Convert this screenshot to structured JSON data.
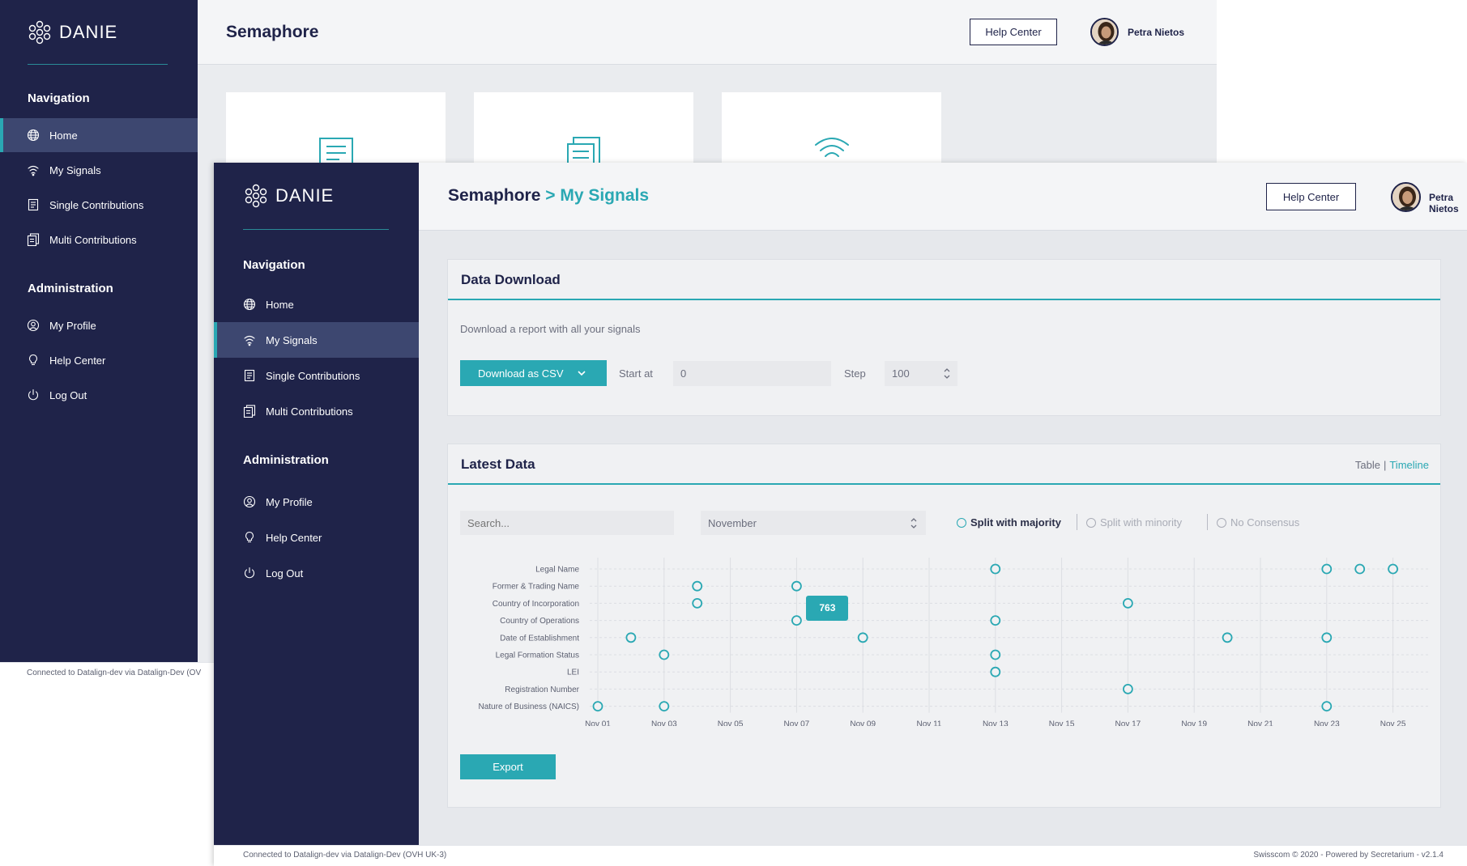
{
  "back_window": {
    "brand": "DANIE",
    "nav_heading": "Navigation",
    "nav": [
      {
        "label": "Home",
        "icon": "globe-icon",
        "active": true
      },
      {
        "label": "My Signals",
        "icon": "signal-icon"
      },
      {
        "label": "Single Contributions",
        "icon": "document-icon"
      },
      {
        "label": "Multi Contributions",
        "icon": "documents-icon"
      }
    ],
    "admin_heading": "Administration",
    "admin": [
      {
        "label": "My Profile",
        "icon": "profile-icon"
      },
      {
        "label": "Help Center",
        "icon": "bulb-icon"
      },
      {
        "label": "Log Out",
        "icon": "power-icon"
      }
    ],
    "title": "Semaphore",
    "help_center": "Help Center",
    "user": "Petra Nietos",
    "footer": "Connected to Datalign-dev via Datalign-Dev (OV",
    "tiles": [
      {
        "icon": "document-icon"
      },
      {
        "icon": "documents-icon"
      },
      {
        "icon": "signal-icon"
      }
    ]
  },
  "front_window": {
    "brand": "DANIE",
    "nav_heading": "Navigation",
    "nav": [
      {
        "label": "Home",
        "icon": "globe-icon"
      },
      {
        "label": "My Signals",
        "icon": "signal-icon",
        "active": true
      },
      {
        "label": "Single Contributions",
        "icon": "document-icon"
      },
      {
        "label": "Multi Contributions",
        "icon": "documents-icon"
      }
    ],
    "admin_heading": "Administration",
    "admin": [
      {
        "label": "My Profile",
        "icon": "profile-icon"
      },
      {
        "label": "Help Center",
        "icon": "bulb-icon"
      },
      {
        "label": "Log Out",
        "icon": "power-icon"
      }
    ],
    "title": "Semaphore",
    "breadcrumb_sep": ">",
    "breadcrumb": "My Signals",
    "help_center": "Help Center",
    "user": "Petra Nietos",
    "data_download": {
      "title": "Data Download",
      "description": "Download a report with all your signals",
      "download_button": "Download as CSV",
      "start_label": "Start at",
      "start_value": "0",
      "step_label": "Step",
      "step_value": "100"
    },
    "latest_data": {
      "title": "Latest Data",
      "view_table": "Table",
      "view_sep": "|",
      "view_timeline": "Timeline",
      "search_placeholder": "Search...",
      "month": "November",
      "filters": [
        {
          "label": "Split with majority",
          "active": true
        },
        {
          "label": "Split with minority",
          "active": false
        },
        {
          "label": "No Consensus",
          "active": false
        }
      ],
      "export_button": "Export",
      "tooltip": "763"
    },
    "footer_left": "Connected to Datalign-dev via Datalign-Dev (OVH UK-3)",
    "footer_right": "Swisscom © 2020 - Powered by Secretarium - v2.1.4"
  },
  "colors": {
    "sidebar": "#1f2349",
    "accent": "#2aa8b3",
    "active_nav": "#3d4770"
  },
  "chart_data": {
    "type": "scatter",
    "x_ticks": [
      "Nov 01",
      "Nov 03",
      "Nov 05",
      "Nov 07",
      "Nov 09",
      "Nov 11",
      "Nov 13",
      "Nov 15",
      "Nov 17",
      "Nov 19",
      "Nov 21",
      "Nov 23",
      "Nov 25"
    ],
    "categories": [
      "Legal Name",
      "Former & Trading Name",
      "Country of Incorporation",
      "Country of Operations",
      "Date of Establishment",
      "Legal Formation Status",
      "LEI",
      "Registration Number",
      "Nature of Business (NAICS)"
    ],
    "x_range": [
      1,
      25
    ],
    "points": [
      {
        "category": "Legal Name",
        "day": 13
      },
      {
        "category": "Legal Name",
        "day": 23
      },
      {
        "category": "Legal Name",
        "day": 24
      },
      {
        "category": "Legal Name",
        "day": 25
      },
      {
        "category": "Former & Trading Name",
        "day": 4
      },
      {
        "category": "Former & Trading Name",
        "day": 7
      },
      {
        "category": "Country of Incorporation",
        "day": 4
      },
      {
        "category": "Country of Incorporation",
        "day": 17
      },
      {
        "category": "Country of Operations",
        "day": 7
      },
      {
        "category": "Country of Operations",
        "day": 13
      },
      {
        "category": "Date of Establishment",
        "day": 2
      },
      {
        "category": "Date of Establishment",
        "day": 9
      },
      {
        "category": "Date of Establishment",
        "day": 20
      },
      {
        "category": "Date of Establishment",
        "day": 23
      },
      {
        "category": "Legal Formation Status",
        "day": 3
      },
      {
        "category": "Legal Formation Status",
        "day": 13
      },
      {
        "category": "LEI",
        "day": 13
      },
      {
        "category": "Registration Number",
        "day": 17
      },
      {
        "category": "Nature of Business (NAICS)",
        "day": 1
      },
      {
        "category": "Nature of Business (NAICS)",
        "day": 3
      },
      {
        "category": "Nature of Business (NAICS)",
        "day": 23
      }
    ],
    "tooltip": {
      "category": "Country of Operations",
      "day": 7,
      "value": "763"
    },
    "grid": true
  }
}
